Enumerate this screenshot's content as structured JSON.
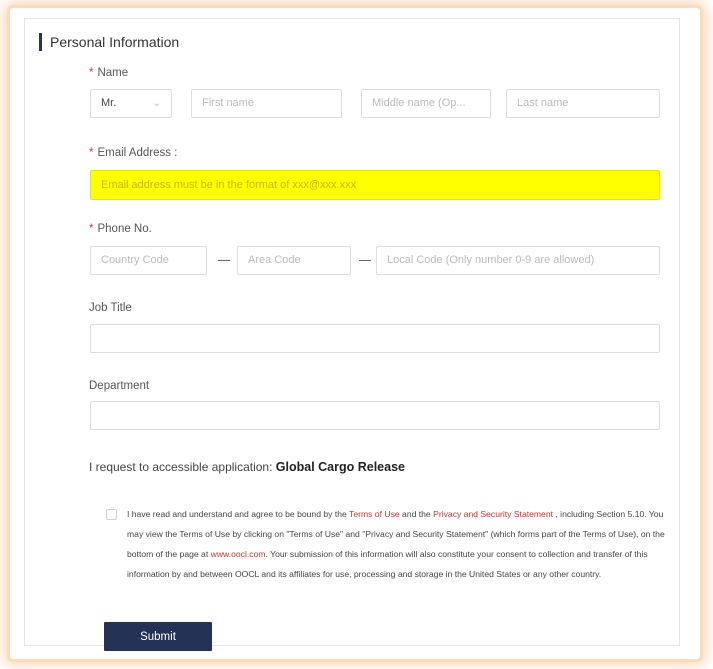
{
  "section": {
    "title": "Personal Information"
  },
  "name": {
    "label": "Name",
    "required_mark": "*",
    "title_value": "Mr.",
    "first_placeholder": "First name",
    "middle_placeholder": "Middle name (Op...",
    "last_placeholder": "Last name"
  },
  "email": {
    "label": "Email Address :",
    "required_mark": "*",
    "placeholder": "Email address must be in the format of xxx@xxx.xxx",
    "highlight_color": "#ffff00"
  },
  "phone": {
    "label": "Phone No.",
    "required_mark": "*",
    "country_placeholder": "Country Code",
    "area_placeholder": "Area Code",
    "local_placeholder": "Local Code (Only number 0-9 are allowed)"
  },
  "job_title": {
    "label": "Job Title",
    "value": ""
  },
  "department": {
    "label": "Department",
    "value": ""
  },
  "request": {
    "prefix": "I request to accessible application: ",
    "application": "Global Cargo Release"
  },
  "terms": {
    "checked": false,
    "text_1": "I have read and understand and agree to be bound by the ",
    "link_terms": "Terms of Use",
    "text_2": " and the ",
    "link_privacy": "Privacy and Security Statement",
    "text_3": " , including Section 5.10. You may view the Terms of Use by clicking on \"Terms of Use\" and \"Privacy and Security Statement\" (which forms part of the Terms of Use), on the bottom of the page at ",
    "link_site": "www.oocl.com",
    "text_4": ". Your submission of this information will also constitute your consent to collection and transfer of this information by and between OOCL and its affiliates for use, processing and storage in the United States or any other country."
  },
  "submit": {
    "label": "Submit"
  },
  "colors": {
    "brand_navy": "#233255",
    "required_red": "#d9363e",
    "link_red": "#c0392b",
    "frame_glow": "#f6b278"
  }
}
